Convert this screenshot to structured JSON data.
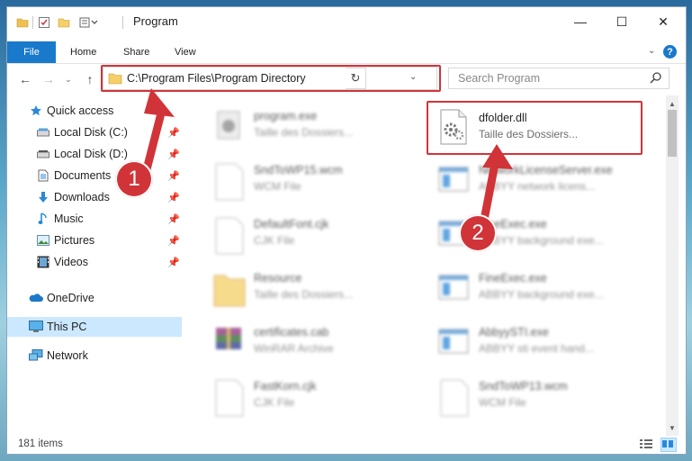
{
  "window": {
    "title": "Program",
    "controls": {
      "minimize": "—",
      "maximize": "☐",
      "close": "✕"
    }
  },
  "ribbon": {
    "tabs": [
      "File",
      "Home",
      "Share",
      "View"
    ],
    "help": "?"
  },
  "address_bar": {
    "path": "C:\\Program Files\\Program Directory"
  },
  "search": {
    "placeholder": "Search Program"
  },
  "sidebar": {
    "items": [
      {
        "label": "Quick access",
        "icon": "star-icon"
      },
      {
        "label": "Local Disk (C:)",
        "icon": "drive-icon",
        "pinned": true
      },
      {
        "label": "Local Disk (D:)",
        "icon": "drive-icon",
        "pinned": true
      },
      {
        "label": "Documents",
        "icon": "documents-icon",
        "pinned": true
      },
      {
        "label": "Downloads",
        "icon": "download-icon",
        "pinned": true
      },
      {
        "label": "Music",
        "icon": "music-icon",
        "pinned": true
      },
      {
        "label": "Pictures",
        "icon": "pictures-icon",
        "pinned": true
      },
      {
        "label": "Videos",
        "icon": "videos-icon",
        "pinned": true
      },
      {
        "label": "OneDrive",
        "icon": "cloud-icon"
      },
      {
        "label": "This PC",
        "icon": "computer-icon",
        "selected": true
      },
      {
        "label": "Network",
        "icon": "network-icon"
      }
    ]
  },
  "files": {
    "left": [
      {
        "name": "program.exe",
        "sub": "Taille des Dossiers..."
      },
      {
        "name": "SndToWP15.wcm",
        "sub": "WCM File"
      },
      {
        "name": "DefaultFont.cjk",
        "sub": "CJK File"
      },
      {
        "name": "Resource",
        "sub": "Taille des Dossiers..."
      },
      {
        "name": "certificates.cab",
        "sub": "WinRAR Archive"
      },
      {
        "name": "FastKorn.cjk",
        "sub": "CJK File"
      }
    ],
    "right": [
      {
        "name": "dfolder.dll",
        "sub": "Taille des Dossiers..."
      },
      {
        "name": "NetworkLicenseServer.exe",
        "sub": "ABBYY network licens..."
      },
      {
        "name": "FineExec.exe",
        "sub": "ABBYY background exe..."
      },
      {
        "name": "FineExec.exe",
        "sub": "ABBYY background exe..."
      },
      {
        "name": "AbbyySTI.exe",
        "sub": "ABBYY sti event hand..."
      },
      {
        "name": "SndToWP13.wcm",
        "sub": "WCM File"
      }
    ]
  },
  "status": {
    "item_count": "181 items"
  },
  "annotations": {
    "step1": "1",
    "step2": "2",
    "color": "#d13438"
  }
}
